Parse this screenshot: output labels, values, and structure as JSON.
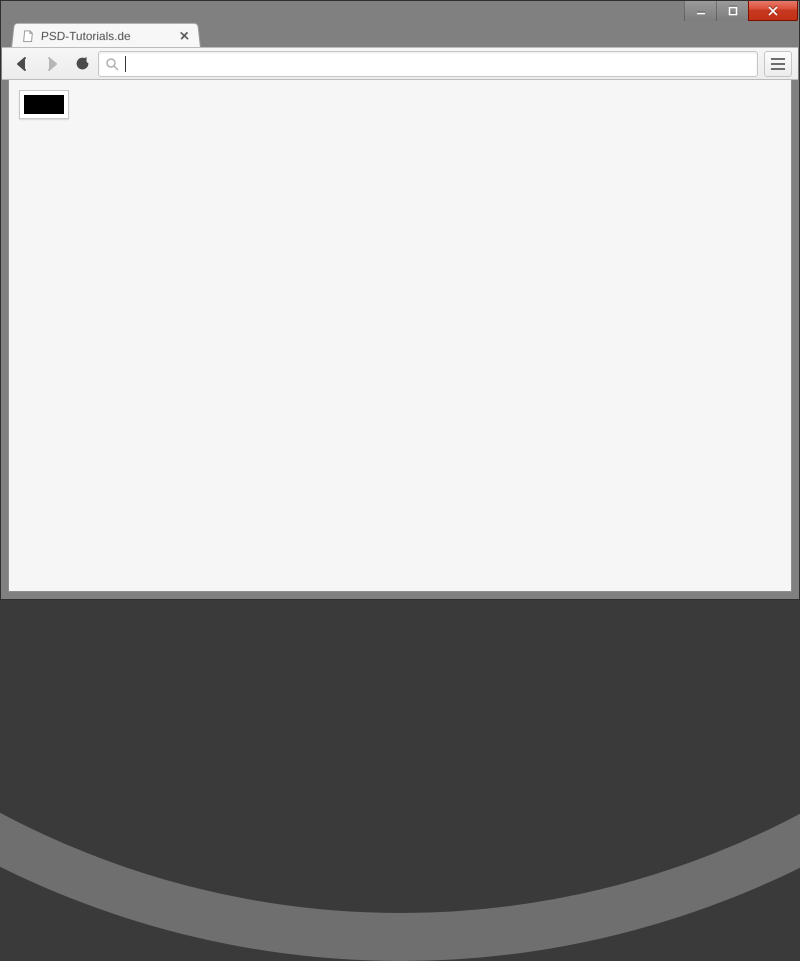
{
  "window": {
    "minimize_icon": "minimize-icon",
    "maximize_icon": "maximize-icon",
    "close_icon": "close-icon"
  },
  "tab": {
    "title": "PSD-Tutorials.de",
    "favicon": "file-icon",
    "close_icon": "close-icon"
  },
  "toolbar": {
    "back_icon": "arrow-left-icon",
    "forward_icon": "arrow-right-icon",
    "reload_icon": "reload-icon",
    "menu_icon": "menu-icon",
    "forward_enabled": false
  },
  "omnibox": {
    "search_icon": "search-icon",
    "value": "",
    "placeholder": ""
  },
  "page": {
    "swatch_color": "#000000"
  }
}
